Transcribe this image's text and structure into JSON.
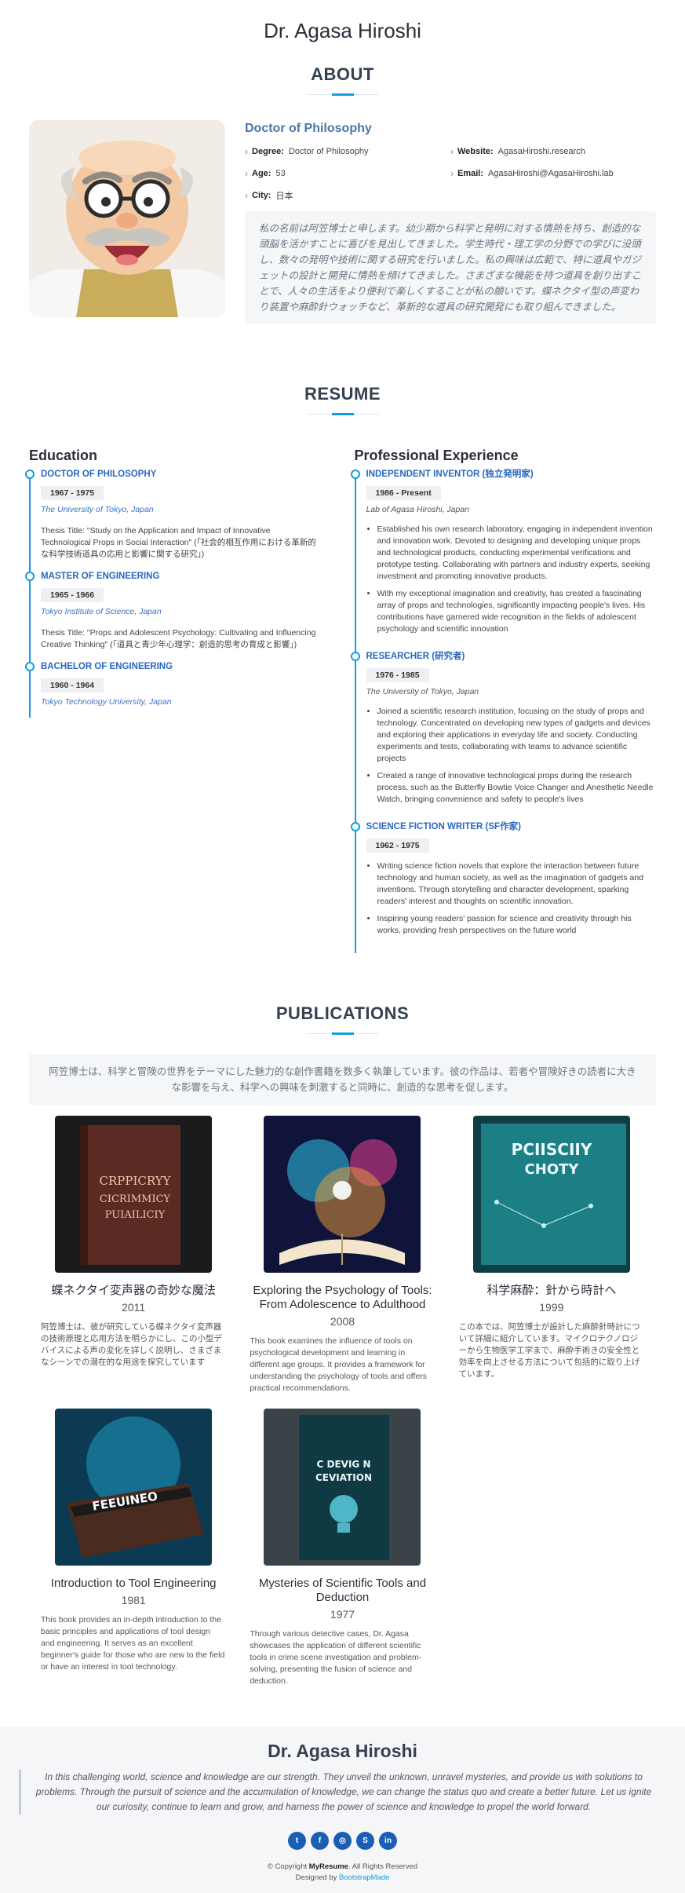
{
  "site": {
    "title": "Dr. Agasa Hiroshi"
  },
  "about": {
    "heading": "ABOUT",
    "role": "Doctor of Philosophy",
    "facts": [
      {
        "label": "Degree:",
        "value": "Doctor of Philosophy"
      },
      {
        "label": "Website:",
        "value": "AgasaHiroshi.research"
      },
      {
        "label": "Age:",
        "value": "53"
      },
      {
        "label": "Email:",
        "value": "AgasaHiroshi@AgasaHiroshi.lab"
      },
      {
        "label": "City:",
        "value": "日本"
      }
    ],
    "bio": "私の名前は阿笠博士と申します。幼少期から科学と発明に対する情熱を持ち、創造的な頭脳を活かすことに喜びを見出してきました。学生時代・理工学の分野での学びに没頭し、数々の発明や技術に関する研究を行いました。私の興味は広範で、特に道具やガジェットの設計と開発に情熱を傾けてきました。さまざまな機能を持つ道具を創り出すことで、人々の生活をより便利で楽しくすることが私の願いです。蝶ネクタイ型の声変わり装置や麻酔針ウォッチなど、革新的な道具の研究開発にも取り組んできました。"
  },
  "resume": {
    "heading": "RESUME",
    "education_title": "Education",
    "experience_title": "Professional Experience",
    "education": [
      {
        "title": "DOCTOR OF PHILOSOPHY",
        "date": "1967 - 1975",
        "place": "The University of Tokyo, Japan",
        "desc": "Thesis Title: \"Study on the Application and Impact of Innovative Technological Props in Social Interaction\" (「社会的相互作用における革新的な科学技術道具の応用と影響に関する研究」)"
      },
      {
        "title": "MASTER OF ENGINEERING",
        "date": "1965 - 1966",
        "place": "Tokyo Institute of Science, Japan",
        "desc": "Thesis Title: \"Props and Adolescent Psychology: Cultivating and Influencing Creative Thinking\" (「道具と青少年心理学：創造的思考の育成と影響」)"
      },
      {
        "title": "BACHELOR OF ENGINEERING",
        "date": "1960 - 1964",
        "place": "Tokyo Technology University, Japan",
        "desc": ""
      }
    ],
    "experience": [
      {
        "title": "INDEPENDENT INVENTOR (独立発明家)",
        "date": "1986 - Present",
        "place": "Lab of Agasa Hiroshi, Japan",
        "bullets": [
          "Established his own research laboratory, engaging in independent invention and innovation work. Devoted to designing and developing unique props and technological products, conducting experimental verifications and prototype testing. Collaborating with partners and industry experts, seeking investment and promoting innovative products.",
          "With my exceptional imagination and creativity, has created a fascinating array of props and technologies, significantly impacting people's lives. His contributions have garnered wide recognition in the fields of adolescent psychology and scientific innovation"
        ]
      },
      {
        "title": "RESEARCHER (研究者)",
        "date": "1976 - 1985",
        "place": "The University of Tokyo, Japan",
        "bullets": [
          "Joined a scientific research institution, focusing on the study of props and technology. Concentrated on developing new types of gadgets and devices and exploring their applications in everyday life and society. Conducting experiments and tests, collaborating with teams to advance scientific projects",
          "Created a range of innovative technological props during the research process, such as the Butterfly Bowtie Voice Changer and Anesthetic Needle Watch, bringing convenience and safety to people's lives"
        ]
      },
      {
        "title": "SCIENCE FICTION WRITER (SF作家)",
        "date": "1962 - 1975",
        "place": "",
        "bullets": [
          "Writing science fiction novels that explore the interaction between future technology and human society, as well as the imagination of gadgets and inventions. Through storytelling and character development, sparking readers' interest and thoughts on scientific innovation.",
          "Inspiring young readers' passion for science and creativity through his works, providing fresh perspectives on the future world"
        ]
      }
    ]
  },
  "publications": {
    "heading": "PUBLICATIONS",
    "intro": "阿笠博士は、科学と冒険の世界をテーマにした魅力的な創作書籍を数多く執筆しています。彼の作品は、若者や冒険好きの読者に大きな影響を与え、科学への興味を刺激すると同時に、創造的な思考を促します。",
    "items": [
      {
        "title": "蝶ネクタイ変声器の奇妙な魔法",
        "year": "2011",
        "cover_text": "CRPPICRYY CICRIMMICY PUIAILICIY",
        "desc": "阿笠博士は、彼が研究している蝶ネクタイ変声器の技術原理と応用方法を明らかにし、この小型デバイスによる声の変化を詳しく説明し、さまざまなシーンでの潜在的な用途を探究しています"
      },
      {
        "title": "Exploring the Psychology of Tools: From Adolescence to Adulthood",
        "year": "2008",
        "cover_text": "",
        "desc": "This book examines the influence of tools on psychological development and learning in different age groups. It provides a framework for understanding the psychology of tools and offers practical recommendations."
      },
      {
        "title": "科学麻酔：針から時計へ",
        "year": "1999",
        "cover_text": "PCIISCIIY CHOTY",
        "desc": "この本では、阿笠博士が設計した麻酔針時計について詳細に紹介しています。マイクロテクノロジーから生物医学工学まで、麻酔手術きの安全性と効率を向上させる方法について包括的に取り上げています。"
      },
      {
        "title": "Introduction to Tool Engineering",
        "year": "1981",
        "cover_text": "FEEUINEO",
        "desc": "This book provides an in-depth introduction to the basic principles and applications of tool design and engineering. It serves as an excellent beginner's guide for those who are new to the field or have an interest in tool technology."
      },
      {
        "title": "Mysteries of Scientific Tools and Deduction",
        "year": "1977",
        "cover_text": "C DEVIG N CEVIATION",
        "desc": "Through various detective cases, Dr. Agasa showcases the application of different scientific tools in crime scene investigation and problem-solving, presenting the fusion of science and deduction."
      }
    ]
  },
  "footer": {
    "name": "Dr. Agasa Hiroshi",
    "quote": "In this challenging world, science and knowledge are our strength. They unveil the unknown, unravel mysteries, and provide us with solutions to problems. Through the pursuit of science and the accumulation of knowledge, we can change the status quo and create a better future. Let us ignite our curiosity, continue to learn and grow, and harness the power of science and knowledge to propel the world forward.",
    "socials": [
      {
        "icon": "twitter-icon",
        "glyph": "t"
      },
      {
        "icon": "facebook-icon",
        "glyph": "f"
      },
      {
        "icon": "instagram-icon",
        "glyph": "◎"
      },
      {
        "icon": "skype-icon",
        "glyph": "S"
      },
      {
        "icon": "linkedin-icon",
        "glyph": "in"
      }
    ],
    "copyright_prefix": "© Copyright",
    "copyright_brand": "MyResume",
    "copyright_suffix": ". All Rights Reserved",
    "designed_by": "Designed by",
    "designer": "BootstrapMade"
  },
  "colors": {
    "accent": "#149ddd",
    "heading": "#36404f",
    "role": "#4a76a8",
    "link": "#2968c0",
    "social": "#1a5fb4"
  }
}
